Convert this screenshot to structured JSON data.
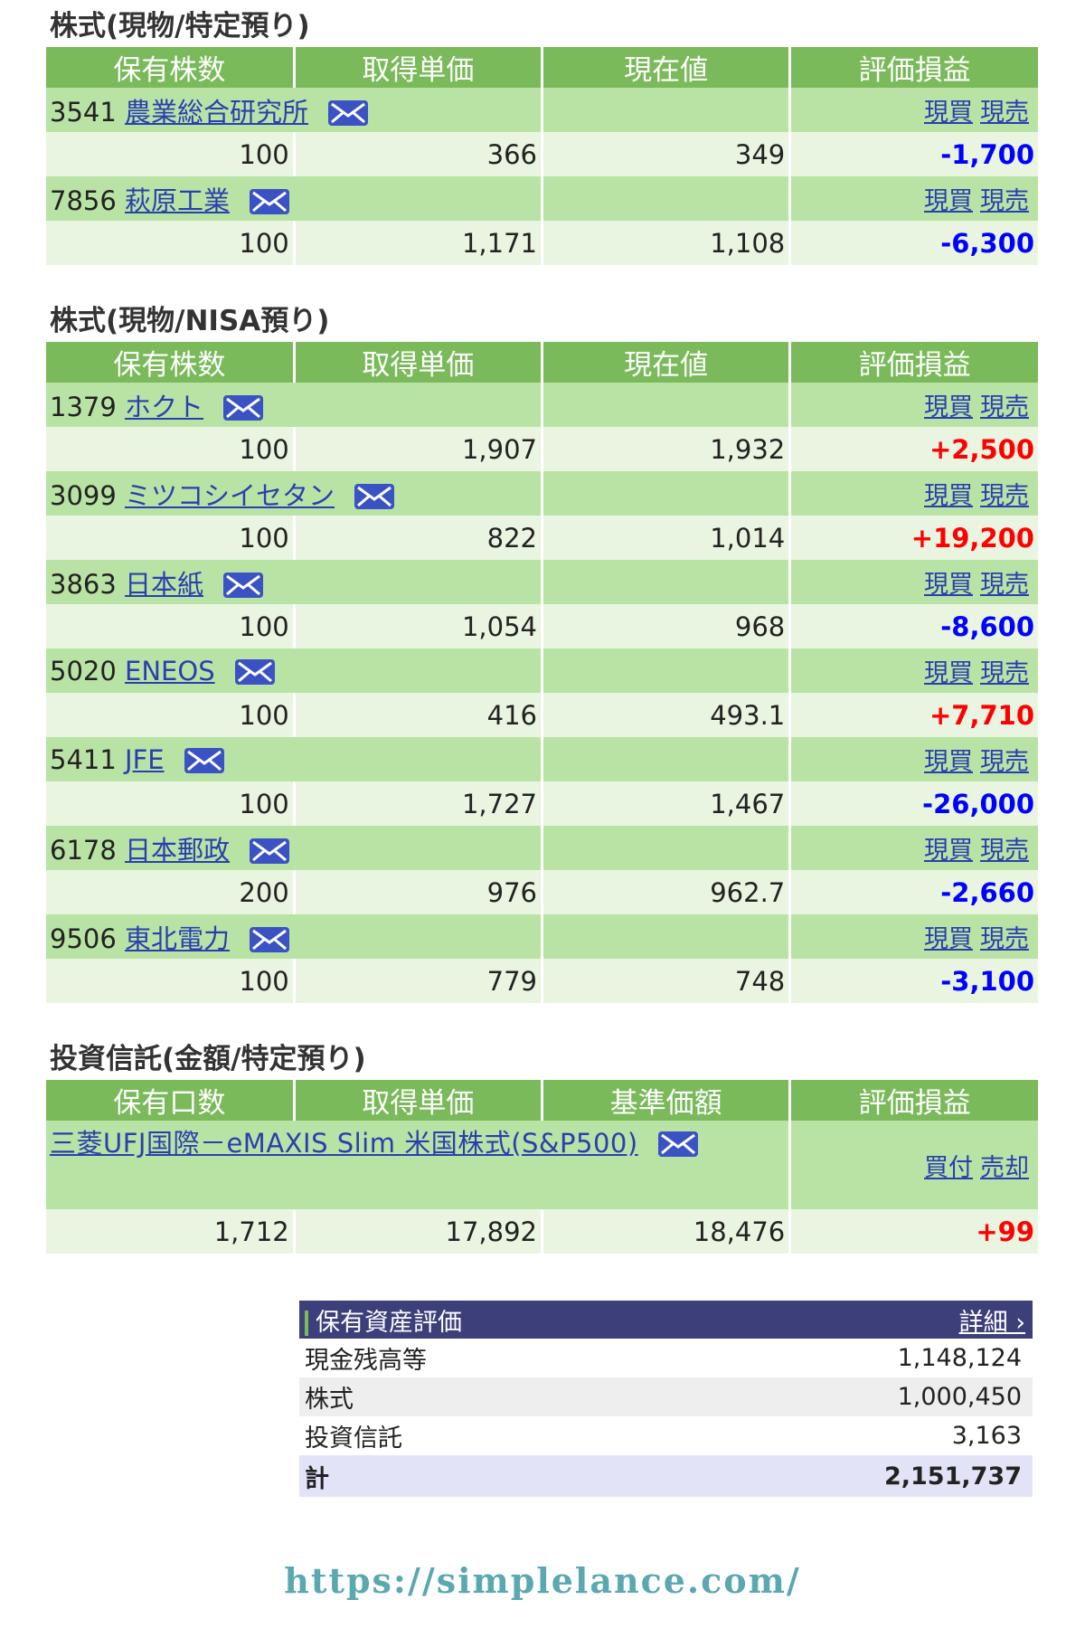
{
  "sections": [
    {
      "title": "株式(現物/特定預り)",
      "headers": [
        "保有株数",
        "取得単価",
        "現在値",
        "評価損益"
      ],
      "rows": [
        {
          "code": "3541",
          "name": "農業総合研究所",
          "buy": "現買",
          "sell": "現売",
          "qty": "100",
          "cost": "366",
          "price": "349",
          "pl": "-1,700"
        },
        {
          "code": "7856",
          "name": "萩原工業",
          "buy": "現買",
          "sell": "現売",
          "qty": "100",
          "cost": "1,171",
          "price": "1,108",
          "pl": "-6,300"
        }
      ]
    },
    {
      "title": "株式(現物/NISA預り)",
      "headers": [
        "保有株数",
        "取得単価",
        "現在値",
        "評価損益"
      ],
      "rows": [
        {
          "code": "1379",
          "name": "ホクト",
          "buy": "現買",
          "sell": "現売",
          "qty": "100",
          "cost": "1,907",
          "price": "1,932",
          "pl": "+2,500"
        },
        {
          "code": "3099",
          "name": "ミツコシイセタン",
          "buy": "現買",
          "sell": "現売",
          "qty": "100",
          "cost": "822",
          "price": "1,014",
          "pl": "+19,200"
        },
        {
          "code": "3863",
          "name": "日本紙",
          "buy": "現買",
          "sell": "現売",
          "qty": "100",
          "cost": "1,054",
          "price": "968",
          "pl": "-8,600"
        },
        {
          "code": "5020",
          "name": "ENEOS",
          "buy": "現買",
          "sell": "現売",
          "qty": "100",
          "cost": "416",
          "price": "493.1",
          "pl": "+7,710"
        },
        {
          "code": "5411",
          "name": "JFE",
          "buy": "現買",
          "sell": "現売",
          "qty": "100",
          "cost": "1,727",
          "price": "1,467",
          "pl": "-26,000"
        },
        {
          "code": "6178",
          "name": "日本郵政",
          "buy": "現買",
          "sell": "現売",
          "qty": "200",
          "cost": "976",
          "price": "962.7",
          "pl": "-2,660"
        },
        {
          "code": "9506",
          "name": "東北電力",
          "buy": "現買",
          "sell": "現売",
          "qty": "100",
          "cost": "779",
          "price": "748",
          "pl": "-3,100"
        }
      ]
    },
    {
      "title": "投資信託(金額/特定預り)",
      "headers": [
        "保有口数",
        "取得単価",
        "基準価額",
        "評価損益"
      ],
      "rows": [
        {
          "name": "三菱UFJ国際－eMAXIS Slim 米国株式(S&P500)",
          "buy": "買付",
          "sell": "売却",
          "qty": "1,712",
          "cost": "17,892",
          "price": "18,476",
          "pl": "+99"
        }
      ]
    }
  ],
  "summary": {
    "title": "保有資産評価",
    "detail_label": "詳細 ›",
    "rows": [
      {
        "label": "現金残高等",
        "value": "1,148,124"
      },
      {
        "label": "株式",
        "value": "1,000,450"
      },
      {
        "label": "投資信託",
        "value": "3,163"
      }
    ],
    "total": {
      "label": "計",
      "value": "2,151,737"
    }
  },
  "footer_url": "https://simplelance.com/",
  "colors": {
    "header_green": "#7aba5a",
    "name_row": "#b9e3a5",
    "value_row": "#eaf5e1",
    "gain": "#ff0000",
    "loss": "#0000ff",
    "summary_head": "#3d3f7a"
  }
}
